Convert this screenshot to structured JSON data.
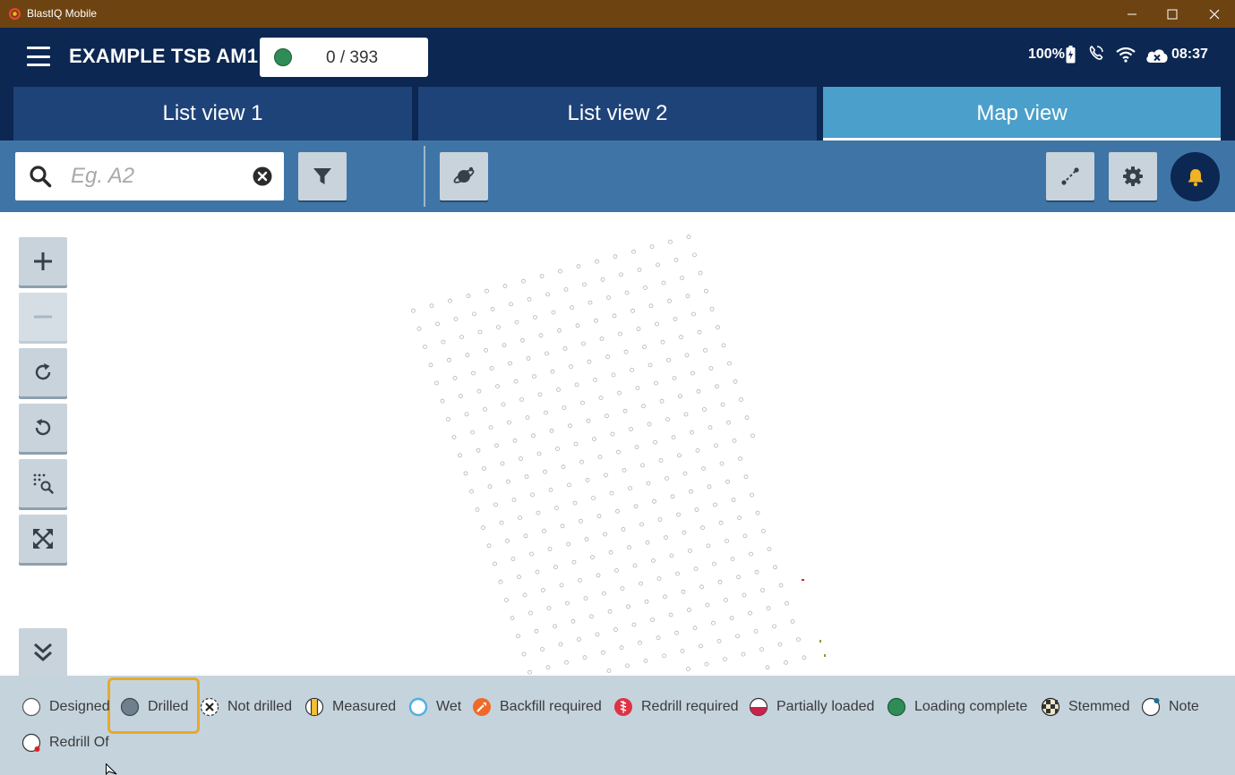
{
  "window": {
    "title": "BlastIQ Mobile",
    "minimize_icon": "minimize-icon",
    "maximize_icon": "maximize-icon",
    "close_icon": "close-icon"
  },
  "header": {
    "title": "EXAMPLE TSB AM1",
    "progress_text": "0 / 393",
    "progress_color": "#2f8c56",
    "battery": "100%",
    "time": "08:37"
  },
  "tabs": [
    {
      "label": "List view 1",
      "active": false
    },
    {
      "label": "List view 2",
      "active": false
    },
    {
      "label": "Map view",
      "active": true
    }
  ],
  "search": {
    "placeholder": "Eg. A2",
    "value": ""
  },
  "icons": {
    "search": "search-icon",
    "clear": "clear-icon",
    "filter": "filter-icon",
    "layers": "planet-icon",
    "measure": "measure-icon",
    "settings": "gear-icon",
    "notifications": "bell-icon",
    "zoom_in": "plus-icon",
    "zoom_out": "minus-icon",
    "rotate_cw": "rotate-cw-icon",
    "rotate_ccw": "rotate-ccw-icon",
    "zoom_select": "zoom-select-icon",
    "fit": "fit-extent-icon",
    "collapse": "chevron-double-down-icon"
  },
  "colors": {
    "titlebar": "#6d4312",
    "header": "#0c2752",
    "tab": "#1e4379",
    "tab_active": "#4a9fcb",
    "toolbar": "#3e75a6",
    "legend_bg": "#c5d3dd",
    "highlight": "#e8a92a",
    "bell": "#f0b323"
  },
  "legend": [
    {
      "label": "Designed",
      "symbol": "designed"
    },
    {
      "label": "Drilled",
      "symbol": "drilled",
      "highlighted": true
    },
    {
      "label": "Not drilled",
      "symbol": "not-drilled"
    },
    {
      "label": "Measured",
      "symbol": "measured"
    },
    {
      "label": "Wet",
      "symbol": "wet"
    },
    {
      "label": "Backfill required",
      "symbol": "backfill"
    },
    {
      "label": "Redrill required",
      "symbol": "redrill"
    },
    {
      "label": "Partially loaded",
      "symbol": "partially-loaded"
    },
    {
      "label": "Loading complete",
      "symbol": "loading-complete"
    },
    {
      "label": "Stemmed",
      "symbol": "stemmed"
    },
    {
      "label": "Note",
      "symbol": "note"
    },
    {
      "label": "Redrill Of",
      "symbol": "redrill-of"
    }
  ]
}
